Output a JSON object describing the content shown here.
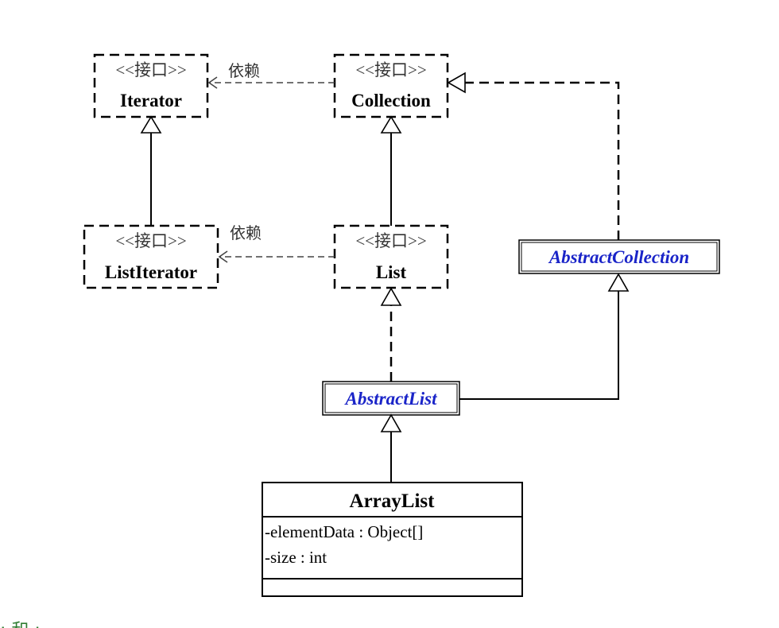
{
  "stereotype": "<<接口>>",
  "dependency_label": "依赖",
  "interfaces": {
    "iterator": "Iterator",
    "collection": "Collection",
    "list_iterator": "ListIterator",
    "list": "List"
  },
  "abstract_classes": {
    "abstract_collection": "AbstractCollection",
    "abstract_list": "AbstractList"
  },
  "array_list": {
    "name": "ArrayList",
    "attributes": [
      "-elementData : Object[]",
      "-size : int"
    ]
  },
  "footer_text": ":  和  :",
  "colors": {
    "abstract_name": "#1a24c8",
    "line": "#000000",
    "footer": "#2f7d32"
  }
}
